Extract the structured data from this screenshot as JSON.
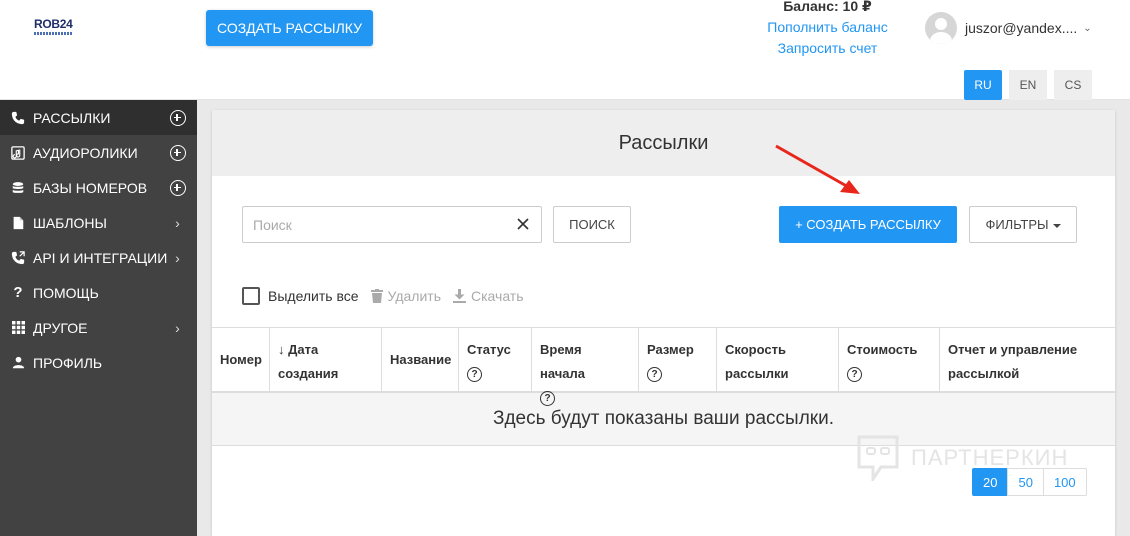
{
  "header": {
    "logo_text": "ROB24",
    "create_button": "Создать рассылку",
    "balance": "Баланс: 10 ₽",
    "topup_link": "Пополнить баланс",
    "invoice_link": "Запросить счет",
    "user_email": "juszor@yandex....",
    "languages": [
      {
        "code": "RU",
        "active": true
      },
      {
        "code": "EN",
        "active": false
      },
      {
        "code": "CS",
        "active": false
      }
    ]
  },
  "sidebar": {
    "items": [
      {
        "label": "Рассылки",
        "icon": "phone-icon",
        "right": "plus"
      },
      {
        "label": "Аудиоролики",
        "icon": "music-icon",
        "right": "plus"
      },
      {
        "label": "Базы номеров",
        "icon": "database-icon",
        "right": "plus"
      },
      {
        "label": "Шаблоны",
        "icon": "file-icon",
        "right": "chevron"
      },
      {
        "label": "API и интеграции",
        "icon": "phone-forward-icon",
        "right": "chevron"
      },
      {
        "label": "Помощь",
        "icon": "question-icon",
        "right": ""
      },
      {
        "label": "Другое",
        "icon": "grid-icon",
        "right": "chevron"
      },
      {
        "label": "Профиль",
        "icon": "person-icon",
        "right": ""
      }
    ]
  },
  "main": {
    "title": "Рассылки",
    "search_placeholder": "Поиск",
    "search_button": "Поиск",
    "create_button": "+ Создать рассылку",
    "filters_button": "Фильтры",
    "select_all": "Выделить все",
    "delete": "Удалить",
    "download": "Скачать",
    "table": {
      "columns": [
        {
          "label": "Номер",
          "help": false,
          "sort": false
        },
        {
          "label": "Дата создания",
          "help": false,
          "sort": true
        },
        {
          "label": "Название",
          "help": false,
          "sort": false
        },
        {
          "label": "Статус",
          "help": true,
          "sort": false
        },
        {
          "label": "Время начала",
          "help": true,
          "sort": false
        },
        {
          "label": "Размер",
          "help": true,
          "sort": false
        },
        {
          "label": "Скорость рассылки",
          "help": false,
          "sort": false
        },
        {
          "label": "Стоимость",
          "help": true,
          "sort": false
        },
        {
          "label": "Отчет и управление рассылкой",
          "help": false,
          "sort": false
        }
      ],
      "empty_message": "Здесь будут показаны ваши рассылки."
    },
    "page_sizes": [
      {
        "value": "20",
        "active": true
      },
      {
        "value": "50",
        "active": false
      },
      {
        "value": "100",
        "active": false
      }
    ]
  },
  "watermark": "ПАРТНЕРКИН",
  "colors": {
    "accent": "#2196f3",
    "sidebar_bg": "#424242",
    "annotation_arrow": "#e8261c"
  }
}
